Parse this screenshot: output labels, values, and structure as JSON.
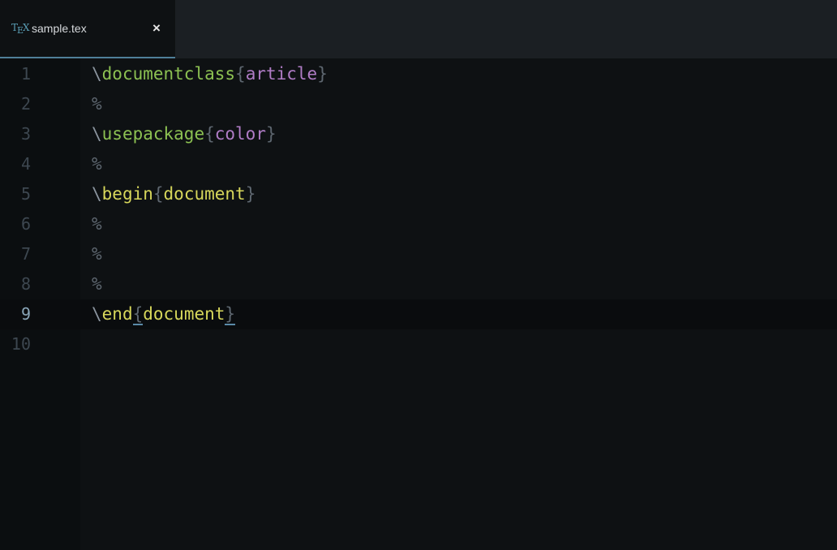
{
  "tab": {
    "icon": "tex-file-icon",
    "icon_text_t": "T",
    "icon_text_e": "E",
    "icon_text_x": "X",
    "title": "sample.tex",
    "close": "×"
  },
  "editor": {
    "current_line": 9,
    "lines": [
      {
        "num": "1",
        "backslash": "\\",
        "command": "documentclass",
        "open": "{",
        "arg": "article",
        "close": "}"
      },
      {
        "num": "2",
        "comment": "%"
      },
      {
        "num": "3",
        "backslash": "\\",
        "command": "usepackage",
        "open": "{",
        "arg": "color",
        "close": "}"
      },
      {
        "num": "4",
        "comment": "%"
      },
      {
        "num": "5",
        "backslash": "\\",
        "command": "begin",
        "open": "{",
        "env": "document",
        "close": "}"
      },
      {
        "num": "6",
        "comment": "%"
      },
      {
        "num": "7",
        "comment": "%"
      },
      {
        "num": "8",
        "comment": "%"
      },
      {
        "num": "9",
        "backslash": "\\",
        "command": "end",
        "open": "{",
        "env": "document",
        "close": "}"
      },
      {
        "num": "10"
      }
    ]
  },
  "colors": {
    "command": "#8cc152",
    "environment": "#d7d75b",
    "argument": "#b07cc6",
    "tab_accent": "#4f7f99"
  }
}
